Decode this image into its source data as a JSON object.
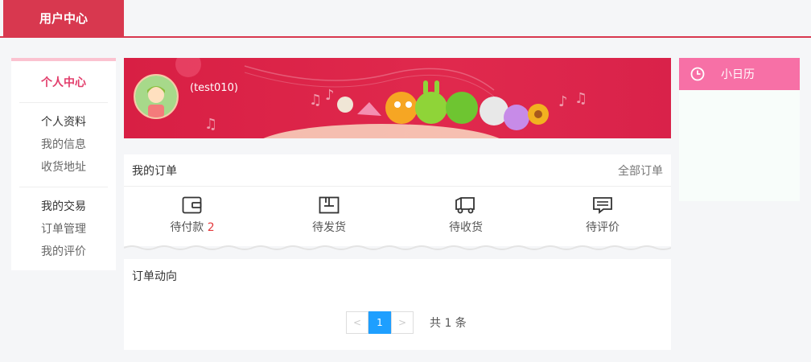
{
  "topbar": {
    "brand": "用户中心"
  },
  "sidebar": {
    "title": "个人中心",
    "groups": [
      {
        "items": [
          {
            "label": "个人资料",
            "head": true
          },
          {
            "label": "我的信息"
          },
          {
            "label": "收货地址"
          }
        ]
      },
      {
        "items": [
          {
            "label": "我的交易",
            "head": true
          },
          {
            "label": "订单管理"
          },
          {
            "label": "我的评价"
          }
        ]
      }
    ]
  },
  "banner": {
    "username": "(test010)"
  },
  "orders": {
    "title": "我的订单",
    "all_link": "全部订单",
    "stats": [
      {
        "label": "待付款",
        "count": "2",
        "icon": "wallet-icon"
      },
      {
        "label": "待发货",
        "icon": "package-icon"
      },
      {
        "label": "待收货",
        "icon": "truck-icon"
      },
      {
        "label": "待评价",
        "icon": "comment-icon"
      }
    ]
  },
  "activity": {
    "title": "订单动向",
    "pager": {
      "prev": "<",
      "current": "1",
      "next": ">",
      "total_text": "共 1 条"
    }
  },
  "calendar": {
    "title": "小日历",
    "icon": "clock-icon"
  },
  "colors": {
    "brand": "#d8384f",
    "accent_pink": "#e23d6b",
    "calendar_head": "#f770a6",
    "pager_active": "#1e9fff",
    "count_red": "#e4393c"
  }
}
